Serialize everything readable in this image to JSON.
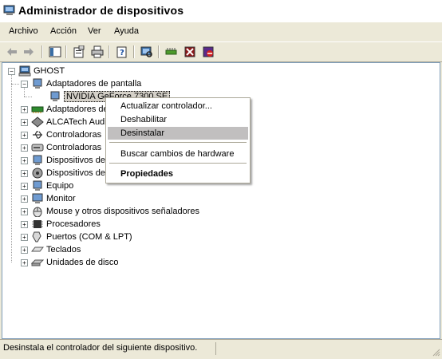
{
  "window": {
    "title": "Administrador de dispositivos"
  },
  "menu": [
    "Archivo",
    "Acción",
    "Ver",
    "Ayuda"
  ],
  "tree": {
    "root": "GHOST",
    "items": [
      {
        "label": "Adaptadores de pantalla",
        "expanded": true
      },
      {
        "label": "NVIDIA GeForce 7300 SE",
        "child": true
      },
      {
        "label": "Adaptadores de red"
      },
      {
        "label": "ALCATech Audio"
      },
      {
        "label": "Controladoras"
      },
      {
        "label": "Controladoras"
      },
      {
        "label": "Dispositivos de"
      },
      {
        "label": "Dispositivos de"
      },
      {
        "label": "Equipo"
      },
      {
        "label": "Monitor"
      },
      {
        "label": "Mouse y otros dispositivos señaladores"
      },
      {
        "label": "Procesadores"
      },
      {
        "label": "Puertos (COM & LPT)"
      },
      {
        "label": "Teclados"
      },
      {
        "label": "Unidades de disco"
      }
    ]
  },
  "context_menu": {
    "items": [
      "Actualizar controlador...",
      "Deshabilitar",
      "Desinstalar",
      "Buscar cambios de hardware",
      "Propiedades"
    ],
    "highlighted": "Desinstalar"
  },
  "status": "Desinstala el controlador del siguiente dispositivo."
}
